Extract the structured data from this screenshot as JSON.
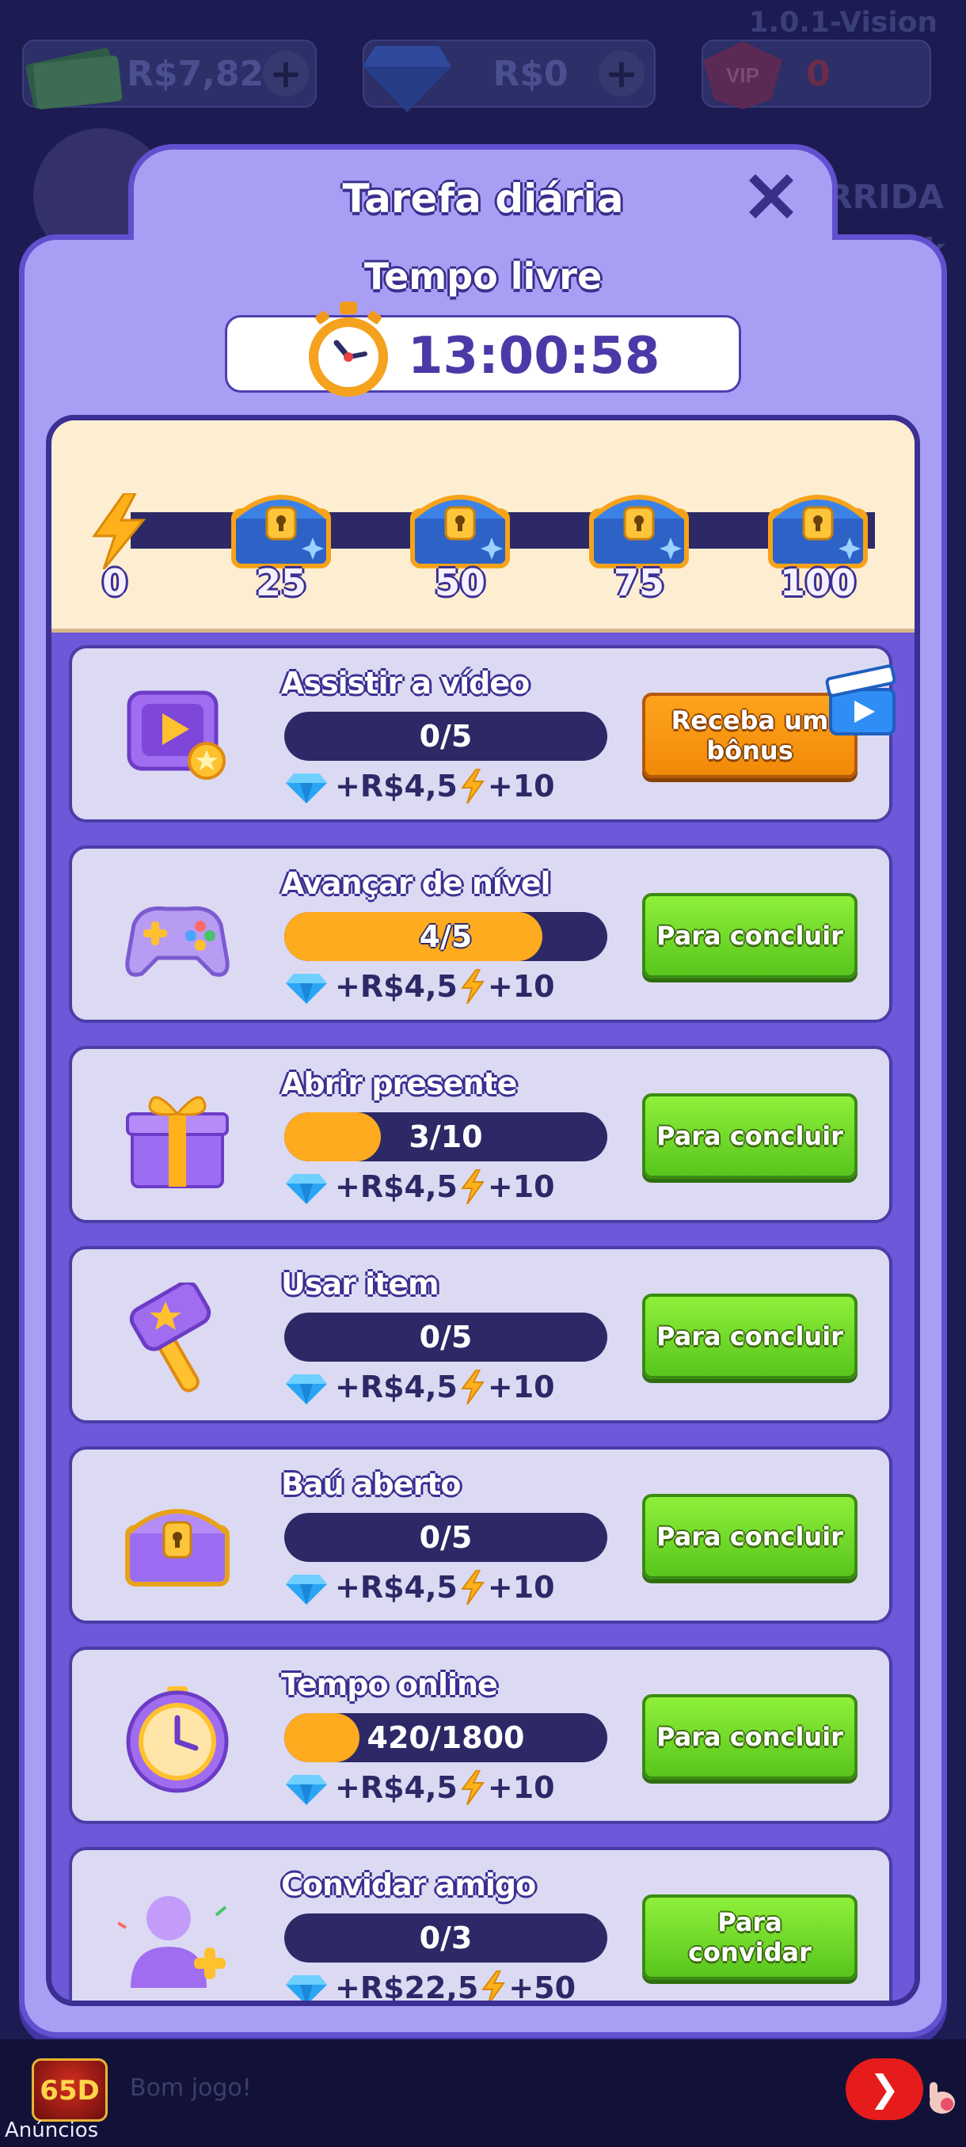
{
  "hud": {
    "version": "1.0.1-Vision",
    "cash": "R$7,82",
    "gems": "R$0",
    "vip_count": "0",
    "right_text_1": "RRIDA",
    "right_text_2": "k"
  },
  "modal": {
    "title": "Tarefa diária",
    "timer_label": "Tempo livre",
    "timer_value": "13:00:58"
  },
  "milestones": [
    "0",
    "25",
    "50",
    "75",
    "100"
  ],
  "tasks": [
    {
      "title": "Assistir a vídeo",
      "progress_text": "0/5",
      "progress": 0.0,
      "cash_reward": "+R$4,5",
      "xp_reward": "+10",
      "button": "Receba um bônus",
      "button_style": "orange"
    },
    {
      "title": "Avançar de nível",
      "progress_text": "4/5",
      "progress": 0.8,
      "cash_reward": "+R$4,5",
      "xp_reward": "+10",
      "button": "Para concluir",
      "button_style": "green"
    },
    {
      "title": "Abrir presente",
      "progress_text": "3/10",
      "progress": 0.3,
      "cash_reward": "+R$4,5",
      "xp_reward": "+10",
      "button": "Para concluir",
      "button_style": "green"
    },
    {
      "title": "Usar item",
      "progress_text": "0/5",
      "progress": 0.0,
      "cash_reward": "+R$4,5",
      "xp_reward": "+10",
      "button": "Para concluir",
      "button_style": "green"
    },
    {
      "title": "Baú aberto",
      "progress_text": "0/5",
      "progress": 0.0,
      "cash_reward": "+R$4,5",
      "xp_reward": "+10",
      "button": "Para concluir",
      "button_style": "green"
    },
    {
      "title": "Tempo online",
      "progress_text": "420/1800",
      "progress": 0.233,
      "cash_reward": "+R$4,5",
      "xp_reward": "+10",
      "button": "Para concluir",
      "button_style": "green"
    },
    {
      "title": "Convidar amigo",
      "progress_text": "0/3",
      "progress": 0.0,
      "cash_reward": "+R$22,5",
      "xp_reward": "+50",
      "button": "Para convidar",
      "button_style": "green"
    }
  ],
  "ad": {
    "logo_text": "65D",
    "label": "Anúncios",
    "text": "Bom jogo!"
  },
  "colors": {
    "panel": "#a89ff5",
    "panel_border": "#6150cf",
    "progress_track": "#2d2967",
    "progress_fill": "#ffab1f",
    "green_button": "#6cd628",
    "orange_button": "#f79612"
  }
}
